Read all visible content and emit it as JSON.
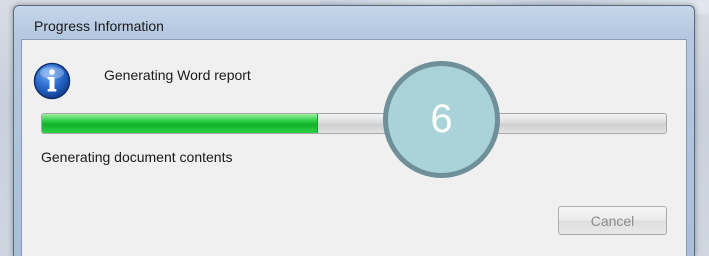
{
  "dialog": {
    "title": "Progress Information",
    "message": "Generating Word report",
    "status": "Generating document contents",
    "progress_percent": 44,
    "cancel_label": "Cancel",
    "cancel_enabled": false,
    "icon": "information-icon"
  },
  "annotation": {
    "step_number": "6"
  },
  "colors": {
    "progress_fill": "#1cc43a",
    "marker_fill": "#a9d3d8",
    "marker_border": "#6f8f99"
  }
}
